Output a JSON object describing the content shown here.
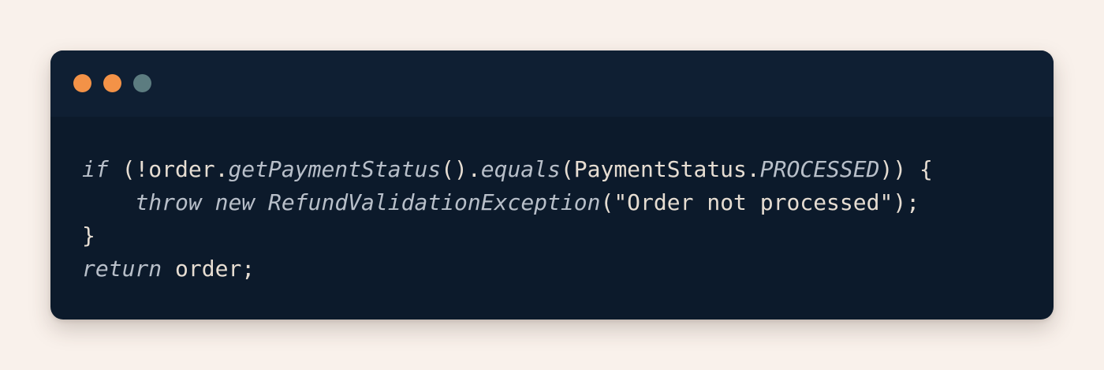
{
  "window": {
    "controls": [
      {
        "name": "close",
        "color": "#f39247"
      },
      {
        "name": "minimize",
        "color": "#f39247"
      },
      {
        "name": "maximize",
        "color": "#5c7c80"
      }
    ]
  },
  "code": {
    "line1": {
      "kw_if": "if",
      "p1": " (!order.",
      "fn_getPaymentStatus": "getPaymentStatus",
      "p2": "().",
      "fn_equals": "equals",
      "p3": "(PaymentStatus.",
      "const_processed": "PROCESSED",
      "p4": ")) {"
    },
    "line2": {
      "indent": "    ",
      "kw_throw": "throw",
      "sp1": " ",
      "kw_new": "new",
      "sp2": " ",
      "cls_exception": "RefundValidationException",
      "p1": "(",
      "str_message": "\"Order not processed\"",
      "p2": ");"
    },
    "line3": {
      "p1": "}"
    },
    "line4": {
      "kw_return": "return",
      "p1": " order;"
    }
  }
}
